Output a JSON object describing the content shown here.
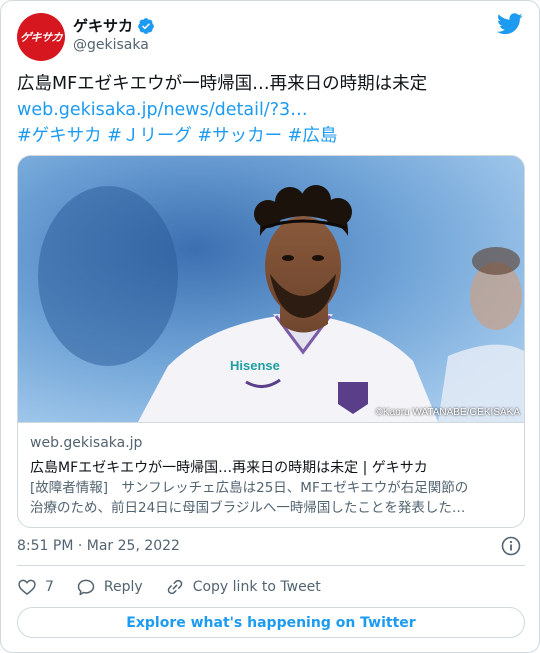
{
  "author": {
    "display_name": "ゲキサカ",
    "handle": "@gekisaka",
    "avatar_text": "ゲキサカ",
    "verified": true
  },
  "tweet": {
    "lines": [
      "広島MFエゼキエウが一時帰国…再来日の時期は未定",
      "web.gekisaka.jp/news/detail/?3…",
      "#ゲキサカ #Ｊリーグ #サッカー #広島"
    ]
  },
  "card": {
    "domain": "web.gekisaka.jp",
    "title": "広島MFエゼキエウが一時帰国…再来日の時期は未定 | ゲキサカ",
    "description_lines": [
      "[故障者情報]　サンフレッチェ広島は25日、MFエゼキエウが右足関節の",
      "治療のため、前日24日に母国ブラジルへ一時帰国したことを発表した…"
    ],
    "image_credit": "©Kaoru WATANABE/GEKISAKA",
    "jersey_sponsor": "Hisense"
  },
  "meta": {
    "timestamp": "8:51 PM · Mar 25, 2022"
  },
  "actions": {
    "like_count": "7",
    "reply_label": "Reply",
    "copy_label": "Copy link to Tweet"
  },
  "footer": {
    "explore_label": "Explore what's happening on Twitter"
  },
  "colors": {
    "brand_red": "#d7171f",
    "twitter_blue": "#1d9bf0",
    "muted": "#536471",
    "border": "#cfd9de"
  }
}
